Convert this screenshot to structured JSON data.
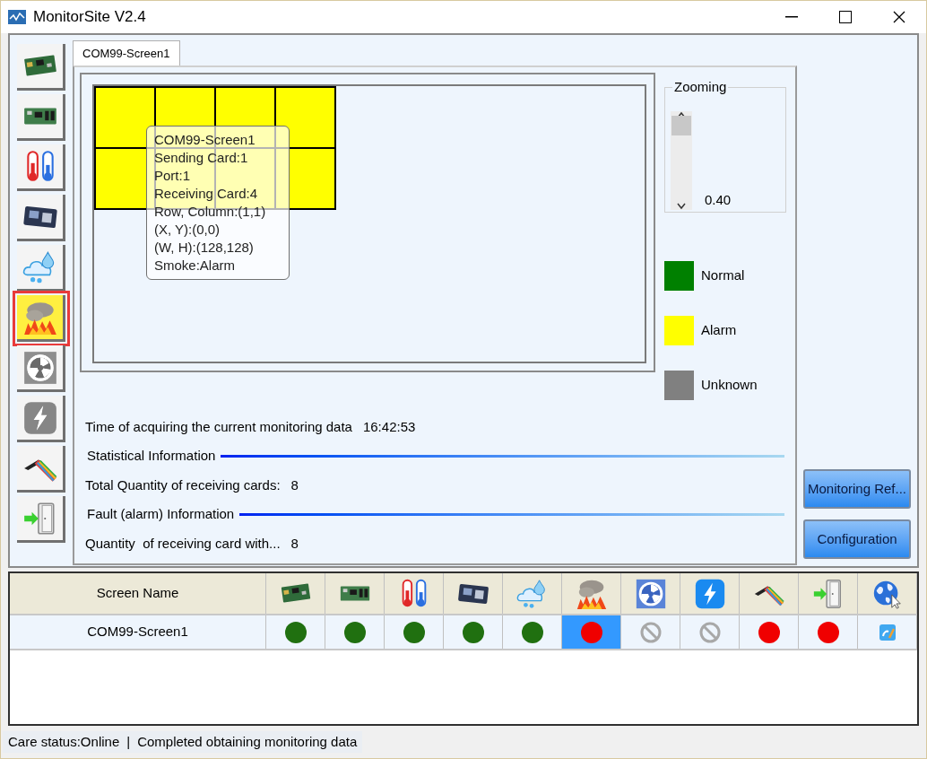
{
  "window": {
    "title": "MonitorSite V2.4"
  },
  "sidebar": {
    "items": [
      {
        "kind": "sending-card",
        "selected": false,
        "disabled": false
      },
      {
        "kind": "receiving-card",
        "selected": false,
        "disabled": false
      },
      {
        "kind": "temperature",
        "selected": false,
        "disabled": false
      },
      {
        "kind": "module-card",
        "selected": false,
        "disabled": false
      },
      {
        "kind": "humidity",
        "selected": false,
        "disabled": false
      },
      {
        "kind": "smoke",
        "selected": true,
        "disabled": false
      },
      {
        "kind": "fan",
        "selected": false,
        "disabled": true
      },
      {
        "kind": "power",
        "selected": false,
        "disabled": true
      },
      {
        "kind": "cable",
        "selected": false,
        "disabled": false
      },
      {
        "kind": "door",
        "selected": false,
        "disabled": false
      }
    ]
  },
  "tabs": [
    {
      "label": "COM99-Screen1",
      "selected": true
    }
  ],
  "screen_map": {
    "cells": [
      {
        "kind": "alarm"
      },
      {
        "kind": "alarm"
      },
      {
        "kind": "alarm"
      },
      {
        "kind": "alarm"
      },
      {
        "kind": "alarm"
      },
      {
        "kind": "alarm"
      },
      {
        "kind": "alarm"
      },
      {
        "kind": "alarm"
      }
    ],
    "tooltip": [
      "COM99-Screen1",
      "Sending Card:1",
      "Port:1",
      "Receiving Card:4",
      "Row, Column:(1,1)",
      "(X, Y):(0,0)",
      "(W, H):(128,128)",
      "Smoke:Alarm"
    ]
  },
  "zooming": {
    "title": "Zooming",
    "value": "0.40"
  },
  "legend": [
    {
      "label": "Normal",
      "color": "#008000"
    },
    {
      "label": "Alarm",
      "color": "#ffff00"
    },
    {
      "label": "Unknown",
      "color": "#808080"
    }
  ],
  "info": [
    {
      "kind": "field",
      "label": "Time of acquiring the current monitoring data",
      "value": "16:42:53"
    },
    {
      "kind": "section",
      "label": "Statistical Information"
    },
    {
      "kind": "field",
      "label": "Total Quantity of receiving cards:",
      "value": "8"
    },
    {
      "kind": "section",
      "label": "Fault (alarm) Information"
    },
    {
      "kind": "field",
      "label": "Quantity  of receiving card with...",
      "value": "8"
    }
  ],
  "buttons": [
    "Monitoring Ref...",
    "Configuration"
  ],
  "table": {
    "columns": [
      {
        "kind": "text",
        "label": "Screen Name"
      },
      {
        "kind": "sending-card"
      },
      {
        "kind": "receiving-card"
      },
      {
        "kind": "temperature"
      },
      {
        "kind": "module-card"
      },
      {
        "kind": "humidity"
      },
      {
        "kind": "smoke"
      },
      {
        "kind": "fan"
      },
      {
        "kind": "power"
      },
      {
        "kind": "cable"
      },
      {
        "kind": "door"
      },
      {
        "kind": "globe"
      }
    ],
    "rows": [
      {
        "name": "COM99-Screen1",
        "cells": [
          {
            "kind": "normal",
            "selected": false
          },
          {
            "kind": "normal",
            "selected": false
          },
          {
            "kind": "normal",
            "selected": false
          },
          {
            "kind": "normal",
            "selected": false
          },
          {
            "kind": "normal",
            "selected": false
          },
          {
            "kind": "alarm",
            "selected": true
          },
          {
            "kind": "disabled",
            "selected": false
          },
          {
            "kind": "disabled",
            "selected": false
          },
          {
            "kind": "alarm",
            "selected": false
          },
          {
            "kind": "alarm",
            "selected": false
          },
          {
            "kind": "edit",
            "selected": false
          }
        ]
      }
    ]
  },
  "status_bar": [
    "Care status:Online",
    "|",
    "Completed obtaining monitoring data"
  ]
}
